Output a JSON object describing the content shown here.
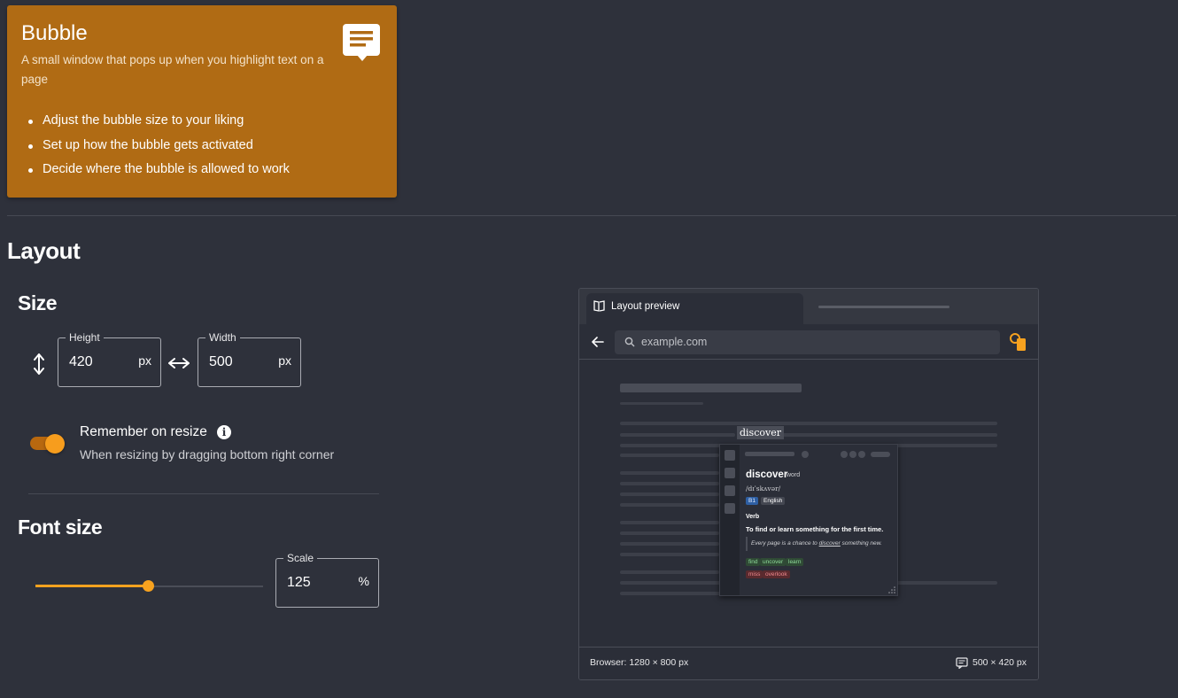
{
  "hero": {
    "title": "Bubble",
    "description": "A small window that pops up when you highlight text on a page",
    "features": [
      "Adjust the bubble size to your liking",
      "Set up how the bubble gets activated",
      "Decide where the bubble is allowed to work"
    ],
    "icon": "chat-bubble-icon",
    "color": "#b06b14"
  },
  "layout": {
    "heading": "Layout",
    "size": {
      "heading": "Size",
      "height": {
        "label": "Height",
        "value": "420",
        "unit": "px"
      },
      "width": {
        "label": "Width",
        "value": "500",
        "unit": "px"
      }
    },
    "remember": {
      "title": "Remember on resize",
      "subtitle": "When resizing by dragging bottom right corner",
      "enabled": true
    },
    "font_size": {
      "heading": "Font size",
      "slider_fraction": 0.5,
      "scale": {
        "label": "Scale",
        "value": "125",
        "unit": "%"
      }
    }
  },
  "preview": {
    "tab_label": "Layout preview",
    "url": "example.com",
    "highlight_word": "discover",
    "bubble": {
      "word": "discover",
      "pos": "word",
      "pronunciation": "/dɪˈskʌvər/",
      "level": "B1",
      "language": "English",
      "part_of_speech": "Verb",
      "definition": "To find or learn something for the first time.",
      "example_before": "Every page is a chance to ",
      "example_word": "discover",
      "example_after": " something new.",
      "synonyms": [
        "find",
        "uncover",
        "learn"
      ],
      "antonyms": [
        "miss",
        "overlook"
      ]
    },
    "footer_browser": "Browser: 1280 × 800 px",
    "footer_bubble": "500 × 420 px"
  },
  "colors": {
    "accent": "#f7a21f",
    "background": "#2e313b"
  }
}
